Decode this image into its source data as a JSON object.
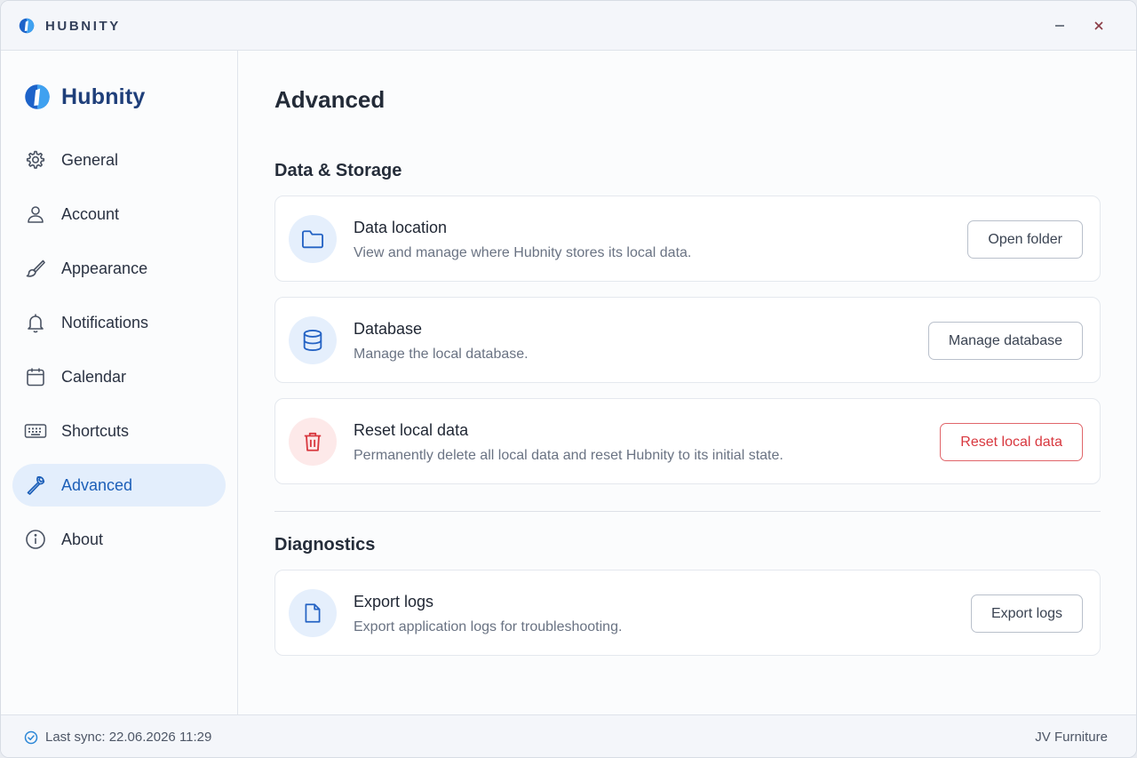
{
  "window": {
    "title": "HUBNITY"
  },
  "sidebar": {
    "brand": "Hubnity",
    "items": [
      {
        "label": "General",
        "icon": "gear-icon",
        "active": false
      },
      {
        "label": "Account",
        "icon": "user-icon",
        "active": false
      },
      {
        "label": "Appearance",
        "icon": "brush-icon",
        "active": false
      },
      {
        "label": "Notifications",
        "icon": "bell-icon",
        "active": false
      },
      {
        "label": "Calendar",
        "icon": "calendar-icon",
        "active": false
      },
      {
        "label": "Shortcuts",
        "icon": "keyboard-icon",
        "active": false
      },
      {
        "label": "Advanced",
        "icon": "wrench-icon",
        "active": true
      },
      {
        "label": "About",
        "icon": "info-icon",
        "active": false
      }
    ]
  },
  "main": {
    "title": "Advanced",
    "sections": [
      {
        "title": "Data & Storage",
        "cards": [
          {
            "title": "Data location",
            "description": "View and manage where Hubnity stores its local data.",
            "button": "Open folder",
            "icon": "folder-icon",
            "danger": false
          },
          {
            "title": "Database",
            "description": "Manage the local database.",
            "button": "Manage database",
            "icon": "database-icon",
            "danger": false
          },
          {
            "title": "Reset local data",
            "description": "Permanently delete all local data and reset Hubnity to its initial state.",
            "button": "Reset local data",
            "icon": "trash-icon",
            "danger": true
          }
        ]
      },
      {
        "title": "Diagnostics",
        "cards": [
          {
            "title": "Export logs",
            "description": "Export application logs for troubleshooting.",
            "button": "Export logs",
            "icon": "file-icon",
            "danger": false
          }
        ]
      }
    ]
  },
  "status": {
    "sync": "Last sync: 22.06.2026 11:29",
    "company": "JV Furniture"
  },
  "colors": {
    "accent": "#1c5fb8",
    "accent_bg": "#e3eefc",
    "danger": "#d8383f",
    "danger_bg": "#fde9e9"
  }
}
